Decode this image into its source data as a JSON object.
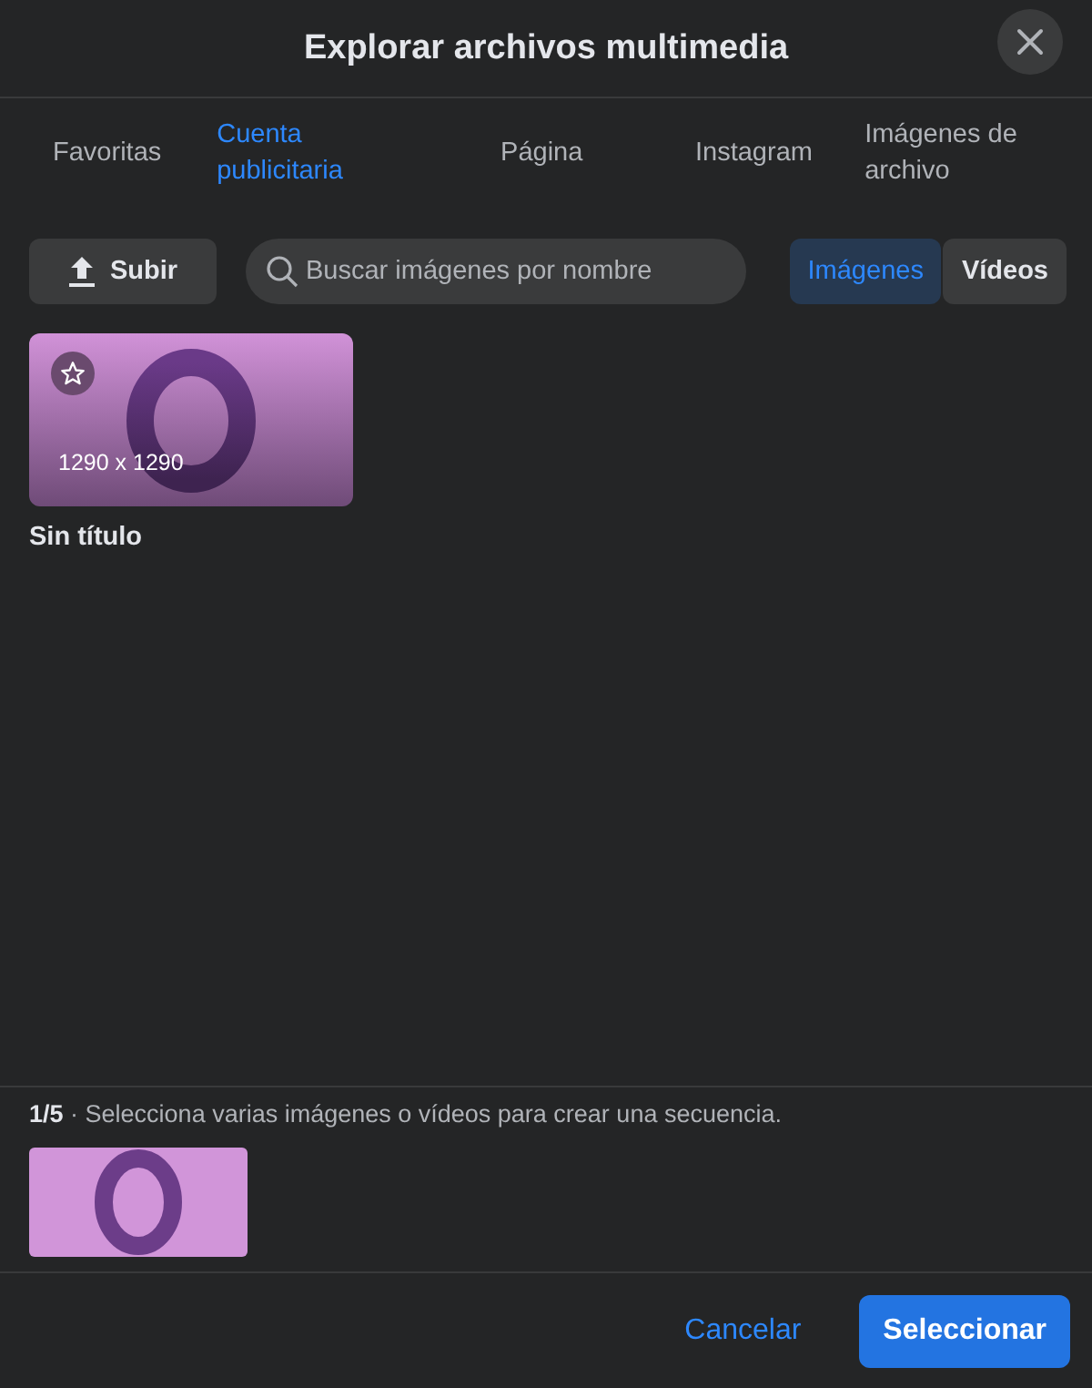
{
  "dialog": {
    "title": "Explorar archivos multimedia"
  },
  "tabs": [
    {
      "label": "Favoritas",
      "selected": false
    },
    {
      "label": "Cuenta publicitaria",
      "selected": true
    },
    {
      "label": "Página",
      "selected": false
    },
    {
      "label": "Instagram",
      "selected": false
    },
    {
      "label": "Imágenes de archivo",
      "selected": false
    }
  ],
  "upload_button": "Subir",
  "search": {
    "placeholder": "Buscar imágenes por nombre"
  },
  "media_type": [
    {
      "label": "Imágenes",
      "selected": true
    },
    {
      "label": "Vídeos",
      "selected": false
    }
  ],
  "items": [
    {
      "kind": "picture",
      "dimensions": "1290 x 1290",
      "title": "Sin título"
    }
  ],
  "selection": {
    "text": "**1/5** · Selecciona varias imágenes o vídeos para crear una secuencia."
  },
  "buttons": {
    "cancel": "Cancelar",
    "confirm": "Seleccionar"
  }
}
